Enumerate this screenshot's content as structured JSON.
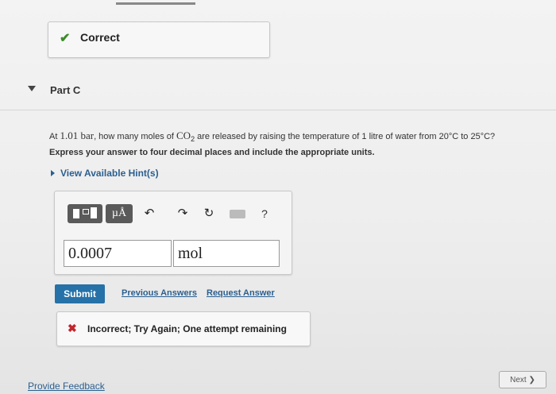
{
  "status": {
    "check_glyph": "✔",
    "label": "Correct",
    "color": "#3c8c2c"
  },
  "part": {
    "title": "Part C"
  },
  "question": {
    "prefix": "At ",
    "pressure": "1.01 bar",
    "middle": ", how many moles of ",
    "compound": "CO",
    "compound_sub": "2",
    "suffix": " are released by raising the temperature of 1 litre of water from 20°C to 25°C?",
    "instruction": "Express your answer to four decimal places and include the appropriate units."
  },
  "hint": {
    "label": "View Available Hint(s)"
  },
  "toolbar": {
    "units_label": "µÅ",
    "undo_glyph": "↶",
    "redo_glyph": "↷",
    "reset_glyph": "↻",
    "help_glyph": "?",
    "icons": [
      "templates-icon",
      "units-icon",
      "undo-icon",
      "redo-icon",
      "reset-icon",
      "keyboard-icon",
      "help-icon"
    ]
  },
  "answer": {
    "value": "0.0007",
    "units": "mol"
  },
  "actions": {
    "submit_label": "Submit",
    "previous_answers_label": "Previous Answers",
    "request_answer_label": "Request Answer"
  },
  "feedback": {
    "x_glyph": "✖",
    "message": "Incorrect; Try Again; One attempt remaining",
    "color": "#c0272d"
  },
  "footer": {
    "next_label": "Next ❯",
    "provide_feedback_label": "Provide Feedback"
  },
  "colors": {
    "accent": "#2671a8",
    "link": "#2b5f8f"
  }
}
